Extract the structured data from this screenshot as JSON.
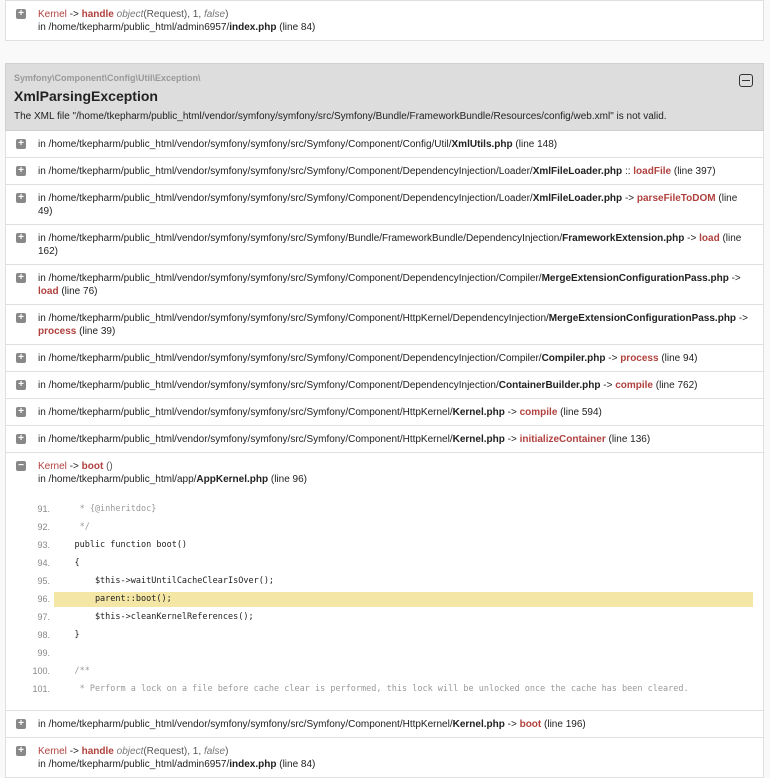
{
  "top_frame": {
    "class": "Kernel",
    "sep": "->",
    "fn": "handle",
    "args_type": "object",
    "args_rest": "(Request), 1, ",
    "args_false": "false",
    "dir": "in /home/tkepharm/public_html/admin6957/",
    "file": "index.php",
    "line": "(line 84)"
  },
  "exception": {
    "namespace": "Symfony\\Component\\Config\\Util\\Exception\\",
    "title": "XmlParsingException",
    "message": "The XML file \"/home/tkepharm/public_html/vendor/symfony/symfony/src/Symfony/Bundle/FrameworkBundle/Resources/config/web.xml\" is not valid."
  },
  "trace": [
    {
      "dir": "in /home/tkepharm/public_html/vendor/symfony/symfony/src/Symfony/Component/Config/Util/",
      "file": "XmlUtils.php",
      "sep": "",
      "fn": "",
      "line": "(line 148)"
    },
    {
      "dir": "in /home/tkepharm/public_html/vendor/symfony/symfony/src/Symfony/Component/DependencyInjection/Loader/",
      "file": "XmlFileLoader.php",
      "sep": "::",
      "fn": "loadFile",
      "line": "(line 397)"
    },
    {
      "dir": "in /home/tkepharm/public_html/vendor/symfony/symfony/src/Symfony/Component/DependencyInjection/Loader/",
      "file": "XmlFileLoader.php",
      "sep": "->",
      "fn": "parseFileToDOM",
      "line": "(line 49)"
    },
    {
      "dir": "in /home/tkepharm/public_html/vendor/symfony/symfony/src/Symfony/Bundle/FrameworkBundle/DependencyInjection/",
      "file": "FrameworkExtension.php",
      "sep": "->",
      "fn": "load",
      "line": "(line 162)"
    },
    {
      "dir": "in /home/tkepharm/public_html/vendor/symfony/symfony/src/Symfony/Component/DependencyInjection/Compiler/",
      "file": "MergeExtensionConfigurationPass.php",
      "sep": "->",
      "fn": "load",
      "line": "(line 76)"
    },
    {
      "dir": "in /home/tkepharm/public_html/vendor/symfony/symfony/src/Symfony/Component/HttpKernel/DependencyInjection/",
      "file": "MergeExtensionConfigurationPass.php",
      "sep": "->",
      "fn": "process",
      "line": "(line 39)"
    },
    {
      "dir": "in /home/tkepharm/public_html/vendor/symfony/symfony/src/Symfony/Component/DependencyInjection/Compiler/",
      "file": "Compiler.php",
      "sep": "->",
      "fn": "process",
      "line": "(line 94)"
    },
    {
      "dir": "in /home/tkepharm/public_html/vendor/symfony/symfony/src/Symfony/Component/DependencyInjection/",
      "file": "ContainerBuilder.php",
      "sep": "->",
      "fn": "compile",
      "line": "(line 762)"
    },
    {
      "dir": "in /home/tkepharm/public_html/vendor/symfony/symfony/src/Symfony/Component/HttpKernel/",
      "file": "Kernel.php",
      "sep": "->",
      "fn": "compile",
      "line": "(line 594)"
    },
    {
      "dir": "in /home/tkepharm/public_html/vendor/symfony/symfony/src/Symfony/Component/HttpKernel/",
      "file": "Kernel.php",
      "sep": "->",
      "fn": "initializeContainer",
      "line": "(line 136)"
    }
  ],
  "expanded": {
    "class": "Kernel",
    "sep": "->",
    "fn": "boot",
    "args": "()",
    "dir": "in /home/tkepharm/public_html/app/",
    "file": "AppKernel.php",
    "line": "(line 96)",
    "code": [
      {
        "n": "91.",
        "t": "     * {@inheritdoc}"
      },
      {
        "n": "92.",
        "t": "     */"
      },
      {
        "n": "93.",
        "t": "    public function boot()"
      },
      {
        "n": "94.",
        "t": "    {"
      },
      {
        "n": "95.",
        "t": "        $this->waitUntilCacheClearIsOver();"
      },
      {
        "n": "96.",
        "t": "        parent::boot();"
      },
      {
        "n": "97.",
        "t": "        $this->cleanKernelReferences();"
      },
      {
        "n": "98.",
        "t": "    }"
      },
      {
        "n": "99.",
        "t": ""
      },
      {
        "n": "100.",
        "t": "    /**"
      },
      {
        "n": "101.",
        "t": "     * Perform a lock on a file before cache clear is performed, this lock will be unlocked once the cache has been cleared."
      }
    ],
    "highlight": "96."
  },
  "trace_after": {
    "dir": "in /home/tkepharm/public_html/vendor/symfony/symfony/src/Symfony/Component/HttpKernel/",
    "file": "Kernel.php",
    "sep": "->",
    "fn": "boot",
    "line": "(line 196)"
  },
  "bottom_frame": {
    "class": "Kernel",
    "sep": "->",
    "fn": "handle",
    "args_type": "object",
    "args_rest": "(Request), 1, ",
    "args_false": "false",
    "dir": "in /home/tkepharm/public_html/admin6957/",
    "file": "index.php",
    "line": "(line 84)"
  }
}
